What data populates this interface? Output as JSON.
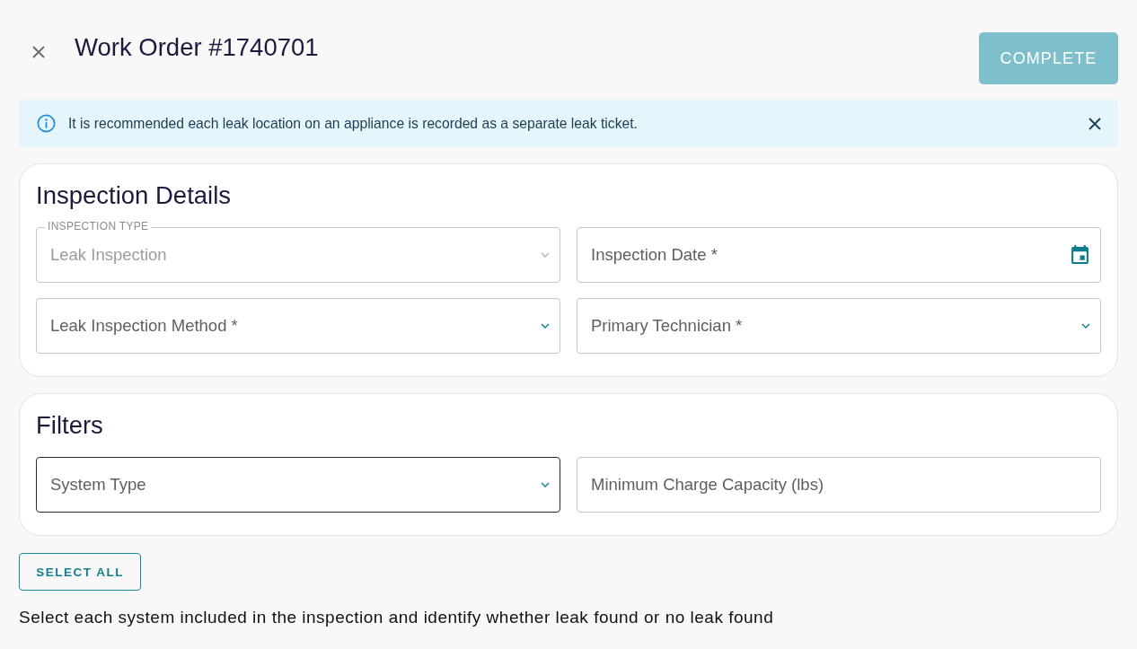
{
  "header": {
    "title": "Work Order #1740701",
    "complete_button": {
      "label": "COMPLETE",
      "disabled": true
    }
  },
  "alert": {
    "text": "It is recommended each leak location on an appliance is recorded as a separate leak ticket."
  },
  "sections": [
    {
      "title": "Inspection Details",
      "fields": [
        {
          "kind": "select",
          "label": "INSPECTION TYPE",
          "value": "Leak Inspection",
          "disabled": true,
          "focused": false
        },
        {
          "kind": "date",
          "placeholder": "Inspection Date *",
          "disabled": false,
          "focused": false
        },
        {
          "kind": "select",
          "placeholder": "Leak Inspection Method *",
          "disabled": false,
          "focused": false
        },
        {
          "kind": "select",
          "placeholder": "Primary Technician *",
          "disabled": false,
          "focused": false
        }
      ]
    },
    {
      "title": "Filters",
      "fields": [
        {
          "kind": "select",
          "placeholder": "System Type",
          "disabled": false,
          "focused": true
        },
        {
          "kind": "text",
          "placeholder": "Minimum Charge Capacity (lbs)",
          "disabled": false,
          "focused": false
        }
      ]
    }
  ],
  "select_all_button": {
    "label": "SELECT ALL"
  },
  "instructions": "Select each system included in the inspection and identify whether leak found or no leak found"
}
